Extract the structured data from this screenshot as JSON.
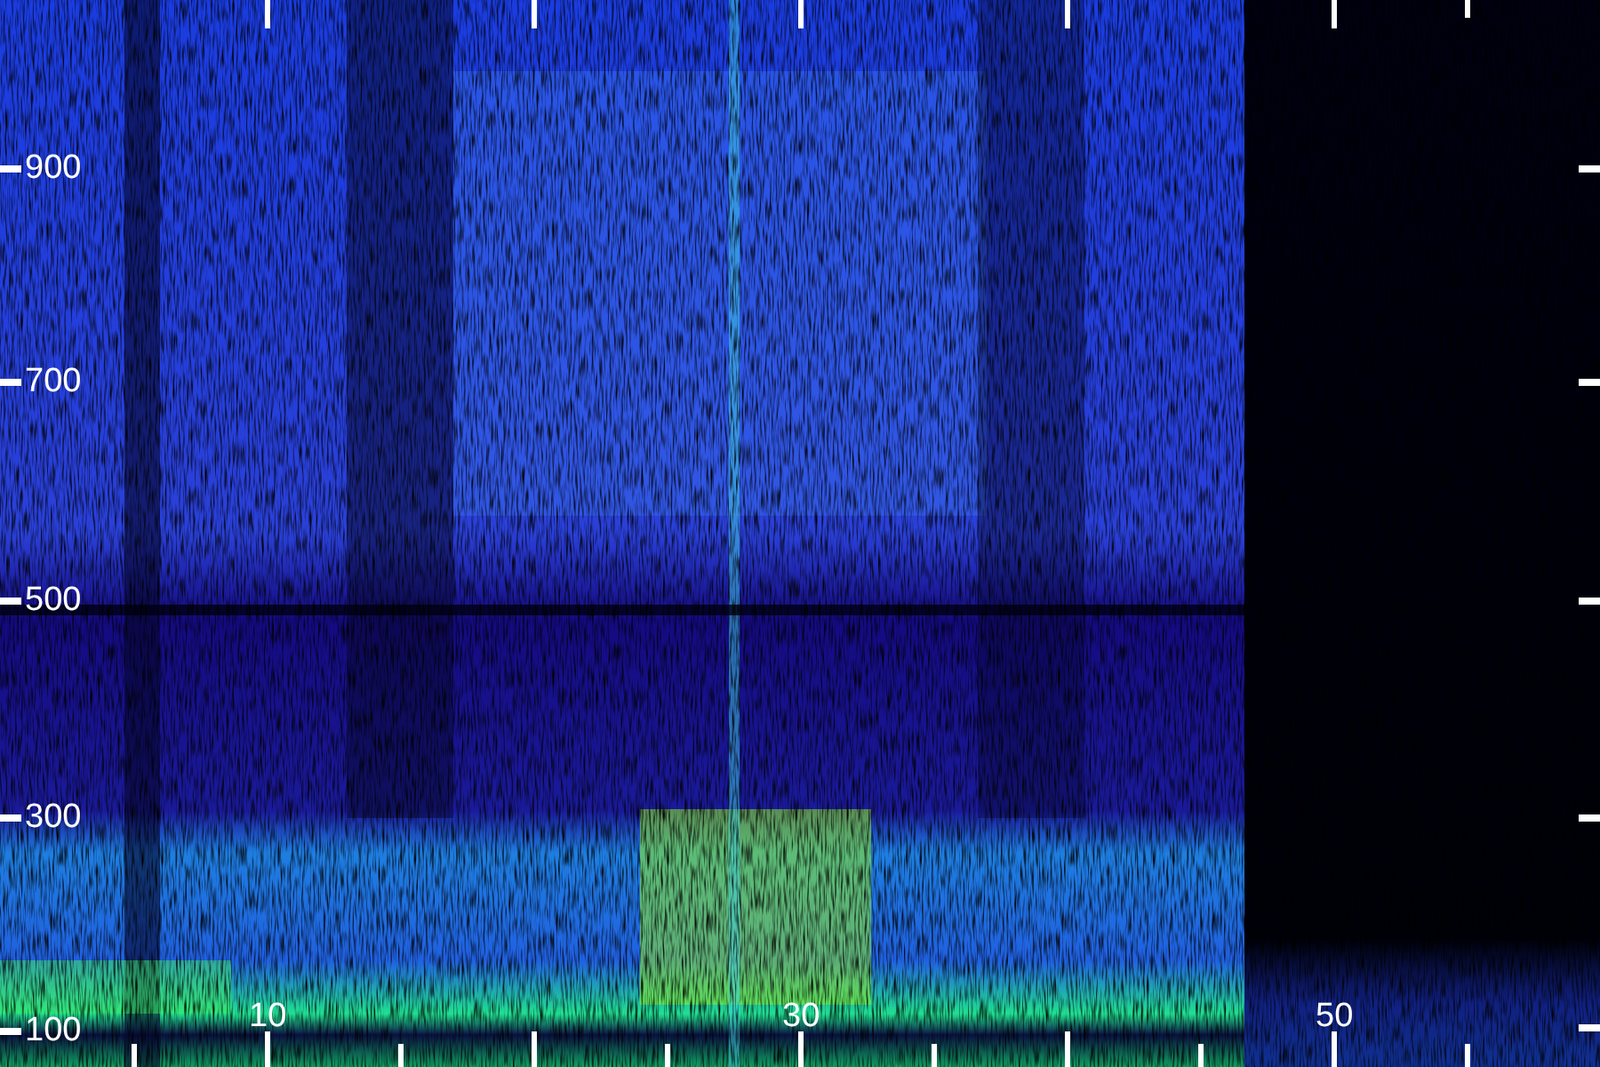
{
  "y_axis_labels": [
    "900",
    "700",
    "500",
    "300",
    "100"
  ],
  "x_axis_labels": [
    "10",
    "30",
    "50"
  ]
}
